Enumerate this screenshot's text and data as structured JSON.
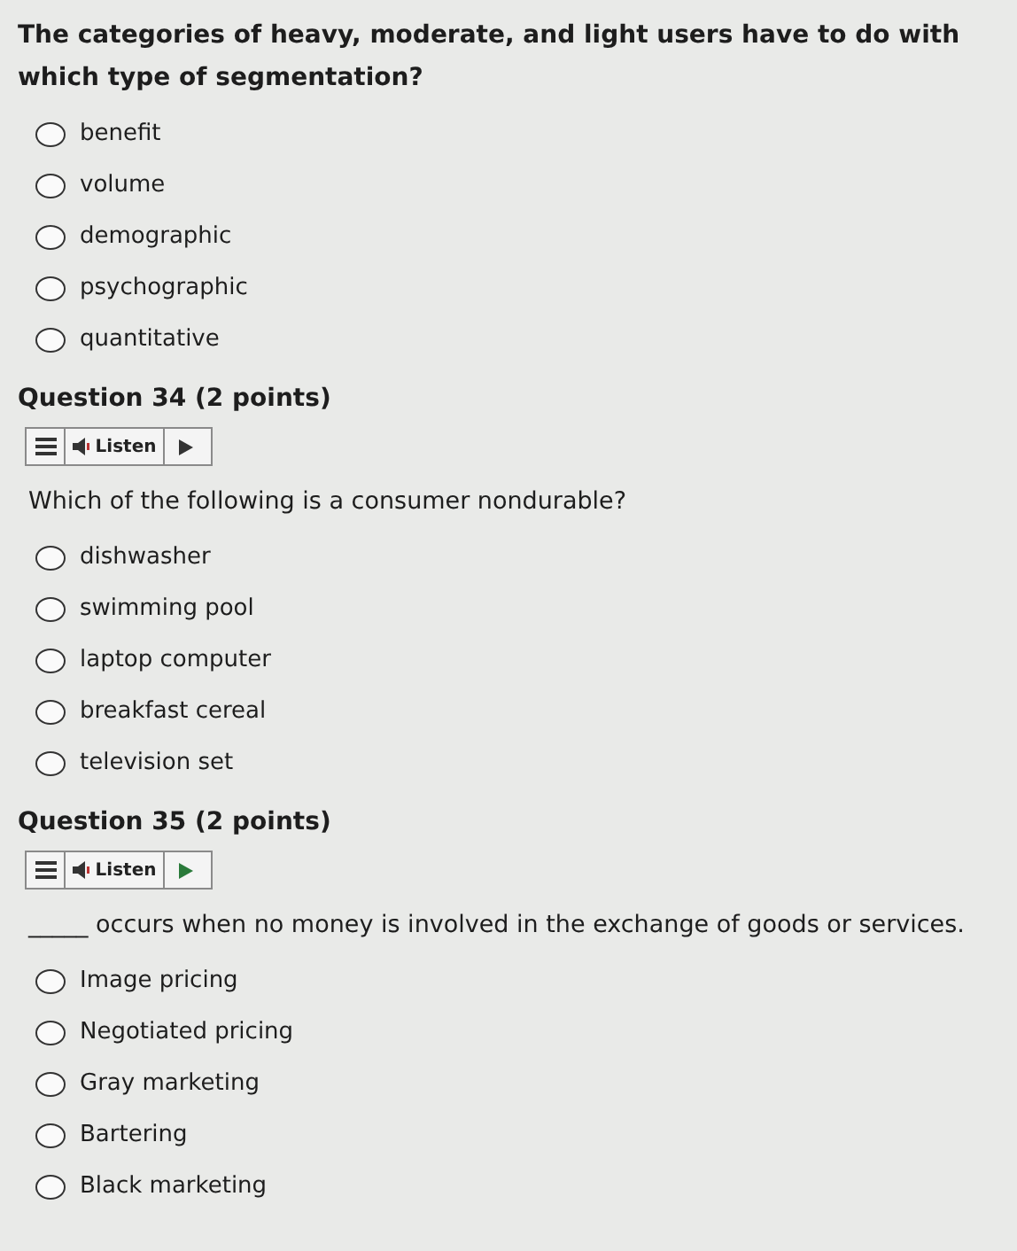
{
  "questions": [
    {
      "prompt": "The categories of heavy, moderate, and light users have to do with which type of segmentation?",
      "options": [
        {
          "label": "benefit",
          "selected": false
        },
        {
          "label": "volume",
          "selected": false
        },
        {
          "label": "demographic",
          "selected": false
        },
        {
          "label": "psychographic",
          "selected": false
        },
        {
          "label": "quantitative",
          "selected": false
        }
      ]
    },
    {
      "title": "Question 34 (2 points)",
      "listen": "Listen",
      "prompt": "Which of the following is a consumer nondurable?",
      "options": [
        {
          "label": "dishwasher",
          "selected": false
        },
        {
          "label": "swimming pool",
          "selected": false
        },
        {
          "label": "laptop computer",
          "selected": false
        },
        {
          "label": "breakfast cereal",
          "selected": false
        },
        {
          "label": "television set",
          "selected": false
        }
      ]
    },
    {
      "title": "Question 35 (2 points)",
      "listen": "Listen",
      "prompt": "_____ occurs when no money is involved in the exchange of goods or services.",
      "options": [
        {
          "label": "Image pricing",
          "selected": false
        },
        {
          "label": "Negotiated pricing",
          "selected": false
        },
        {
          "label": "Gray marketing",
          "selected": false
        },
        {
          "label": "Bartering",
          "selected": false
        },
        {
          "label": "Black marketing",
          "selected": false
        }
      ]
    }
  ]
}
